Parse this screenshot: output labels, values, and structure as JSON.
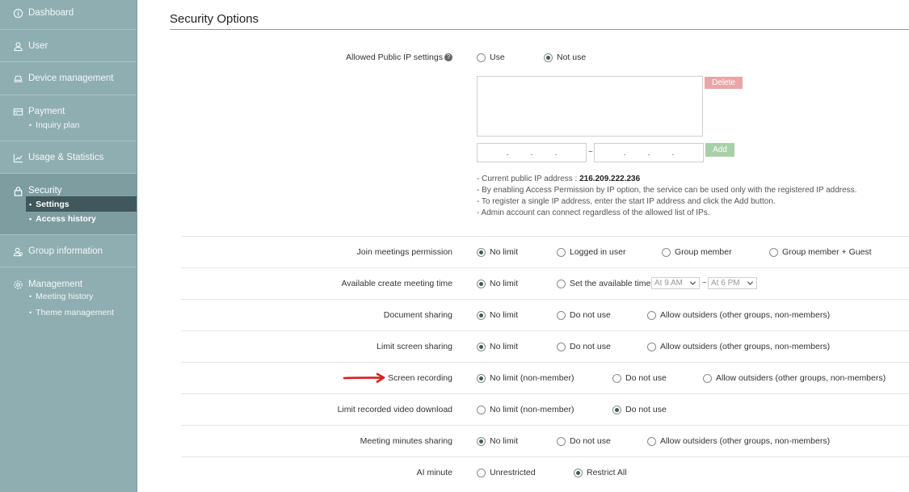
{
  "sidebar": {
    "items": [
      {
        "label": "Dashboard",
        "icon": "info-circle-icon"
      },
      {
        "label": "User",
        "icon": "user-icon"
      },
      {
        "label": "Device management",
        "icon": "monitor-icon"
      },
      {
        "label": "Payment",
        "icon": "card-icon",
        "sub": [
          "Inquiry plan"
        ]
      },
      {
        "label": "Usage & Statistics",
        "icon": "chart-icon"
      },
      {
        "label": "Security",
        "icon": "lock-icon",
        "sub": [
          "Settings",
          "Access history"
        ]
      },
      {
        "label": "Group information",
        "icon": "group-icon"
      },
      {
        "label": "Management",
        "icon": "gear-icon",
        "sub": [
          "Meeting history",
          "Theme management"
        ]
      }
    ]
  },
  "page": {
    "title": "Security Options"
  },
  "ip": {
    "label": "Allowed Public IP settings",
    "opt_use": "Use",
    "opt_not_use": "Not use",
    "delete": "Delete",
    "add": "Add",
    "tilde": "~",
    "notes_prefix": "- Current public IP address : ",
    "current_ip": "216.209.222.236",
    "note2": "- By enabling Access Permission by IP option, the service can be used only with the registered IP address.",
    "note3": "- To register a single IP address, enter the start IP address and click the Add button.",
    "note4": "- Admin account can connect regardless of the allowed list of IPs."
  },
  "settings": {
    "join": {
      "label": "Join meetings permission",
      "o1": "No limit",
      "o2": "Logged in user",
      "o3": "Group member",
      "o4": "Group member + Guest"
    },
    "create": {
      "label": "Available create meeting time",
      "o1": "No limit",
      "o2": "Set the available time",
      "start": "At 9 AM",
      "end": "At 6 PM",
      "sep": "~"
    },
    "doc": {
      "label": "Document sharing",
      "o1": "No limit",
      "o2": "Do not use",
      "o3": "Allow outsiders (other groups, non-members)"
    },
    "screen": {
      "label": "Limit screen sharing",
      "o1": "No limit",
      "o2": "Do not use",
      "o3": "Allow outsiders (other groups, non-members)"
    },
    "record": {
      "label": "Screen recording",
      "o1": "No limit (non-member)",
      "o2": "Do not use",
      "o3": "Allow outsiders (other groups, non-members)"
    },
    "download": {
      "label": "Limit recorded video download",
      "o1": "No limit (non-member)",
      "o2": "Do not use"
    },
    "minutes": {
      "label": "Meeting minutes sharing",
      "o1": "No limit",
      "o2": "Do not use",
      "o3": "Allow outsiders (other groups, non-members)"
    },
    "ai": {
      "label": "AI minute",
      "o1": "Unrestricted",
      "o2": "Restrict All"
    }
  },
  "colors": {
    "sidebar": "#8faeb2",
    "active_sub": "#40575b",
    "delete": "#e8a7a7",
    "add": "#a8d0a8",
    "annotation": "#d9201d"
  }
}
